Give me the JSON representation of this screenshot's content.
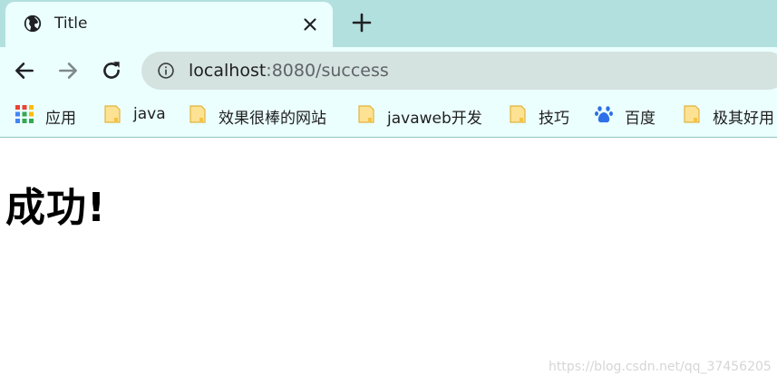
{
  "tab": {
    "title": "Title"
  },
  "address": {
    "host": "localhost",
    "port_path": ":8080/success"
  },
  "bookmarks": [
    {
      "label": "应用",
      "icon": "apps-grid-icon"
    },
    {
      "label": "java",
      "icon": "folder-icon"
    },
    {
      "label": "效果很棒的网站",
      "icon": "folder-icon"
    },
    {
      "label": "javaweb开发",
      "icon": "folder-icon"
    },
    {
      "label": "技巧",
      "icon": "folder-icon"
    },
    {
      "label": "百度",
      "icon": "baidu-paw-icon"
    },
    {
      "label": "极其好用",
      "icon": "folder-icon"
    }
  ],
  "page": {
    "heading": "成功!"
  },
  "watermark": "https://blog.csdn.net/qq_37456205",
  "colors": {
    "tab_strip": "#b2e0de",
    "toolbar": "#ebfffe",
    "omnibox": "#d4e2e0"
  }
}
